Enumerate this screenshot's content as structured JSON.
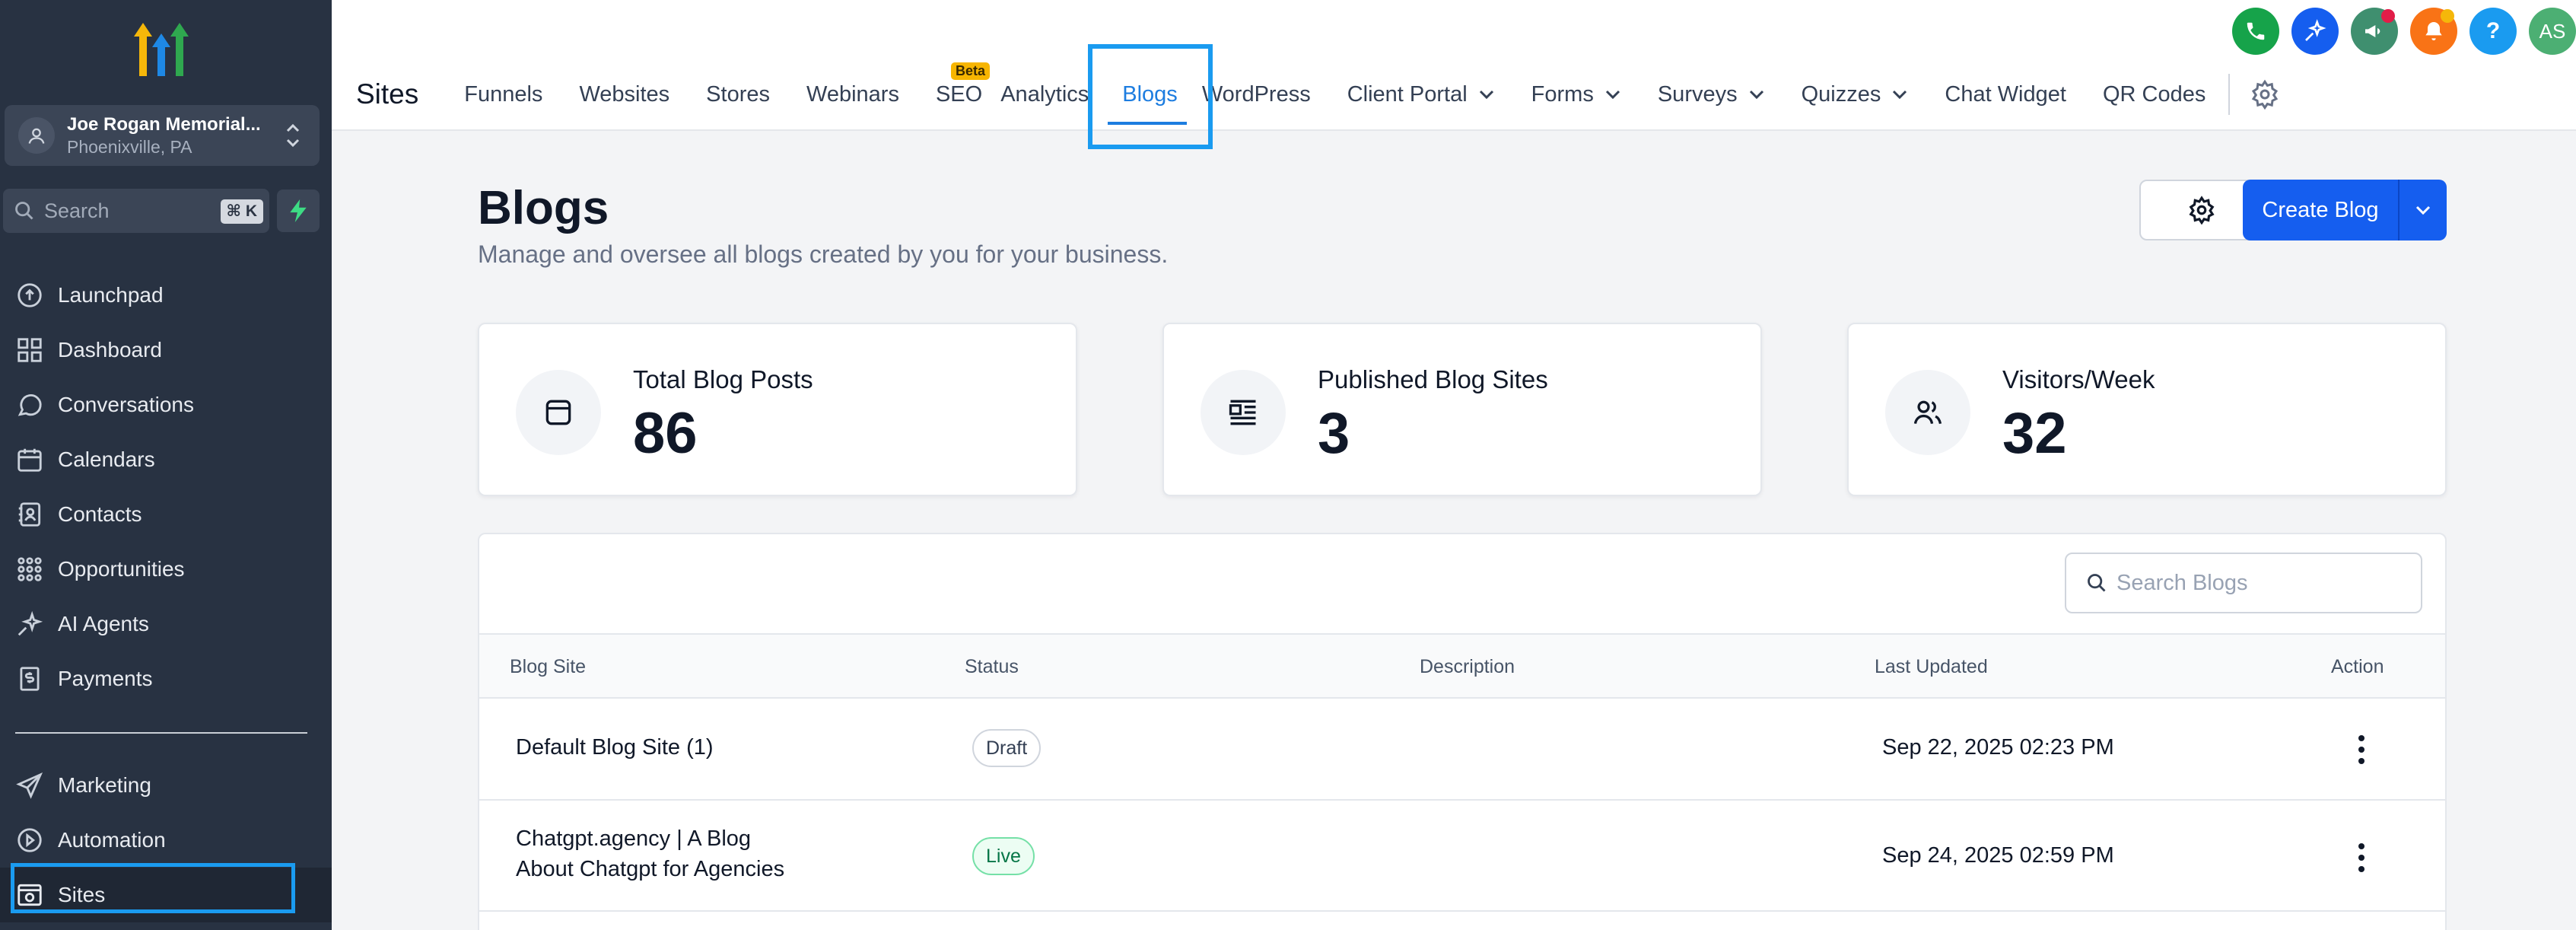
{
  "sidebar": {
    "location": {
      "name": "Joe Rogan Memorial...",
      "city": "Phoenixville, PA"
    },
    "search": {
      "placeholder": "Search",
      "shortcut": "⌘ K"
    },
    "items": [
      {
        "label": "Launchpad",
        "icon": "launchpad-icon"
      },
      {
        "label": "Dashboard",
        "icon": "dashboard-icon"
      },
      {
        "label": "Conversations",
        "icon": "chat-bubble-icon"
      },
      {
        "label": "Calendars",
        "icon": "calendar-icon"
      },
      {
        "label": "Contacts",
        "icon": "contacts-icon"
      },
      {
        "label": "Opportunities",
        "icon": "opportunities-icon"
      },
      {
        "label": "AI Agents",
        "icon": "ai-agents-icon"
      },
      {
        "label": "Payments",
        "icon": "payments-icon"
      }
    ],
    "items2": [
      {
        "label": "Marketing",
        "icon": "send-icon"
      },
      {
        "label": "Automation",
        "icon": "automation-icon"
      },
      {
        "label": "Sites",
        "icon": "sites-icon"
      }
    ]
  },
  "topbar": {
    "section_title": "Sites",
    "tabs": [
      "Funnels",
      "Websites",
      "Stores",
      "Webinars",
      "SEO",
      "Analytics",
      "Blogs",
      "WordPress",
      "Client Portal",
      "Forms",
      "Surveys",
      "Quizzes",
      "Chat Widget",
      "QR Codes"
    ],
    "seo_badge": "Beta",
    "active_tab": "Blogs",
    "avatar_initials": "AS",
    "help_label": "?",
    "icon_colors": {
      "phone": "#16a34a",
      "ai": "#155eef",
      "announce": "#3f8f6f",
      "bell": "#f97316",
      "help": "#1a9bf0",
      "avatar": "#4caf73"
    }
  },
  "page": {
    "title": "Blogs",
    "subtitle": "Manage and oversee all blogs created by you for your business.",
    "create_button": "Create Blog"
  },
  "stats": [
    {
      "label": "Total Blog Posts",
      "value": "86",
      "icon": "blog-post-icon"
    },
    {
      "label": "Published Blog Sites",
      "value": "3",
      "icon": "blog-sites-icon"
    },
    {
      "label": "Visitors/Week",
      "value": "32",
      "icon": "visitors-icon"
    }
  ],
  "table": {
    "search_placeholder": "Search Blogs",
    "columns": [
      "Blog Site",
      "Status",
      "Description",
      "Last Updated",
      "Action"
    ],
    "rows": [
      {
        "name": "Default Blog Site (1)",
        "status": "Draft",
        "description": "",
        "updated": "Sep 22, 2025 02:23 PM"
      },
      {
        "name_line1": "Chatgpt.agency | A Blog",
        "name_line2": "About Chatgpt for Agencies",
        "status": "Live",
        "description": "",
        "updated": "Sep 24, 2025 02:59 PM"
      }
    ]
  }
}
